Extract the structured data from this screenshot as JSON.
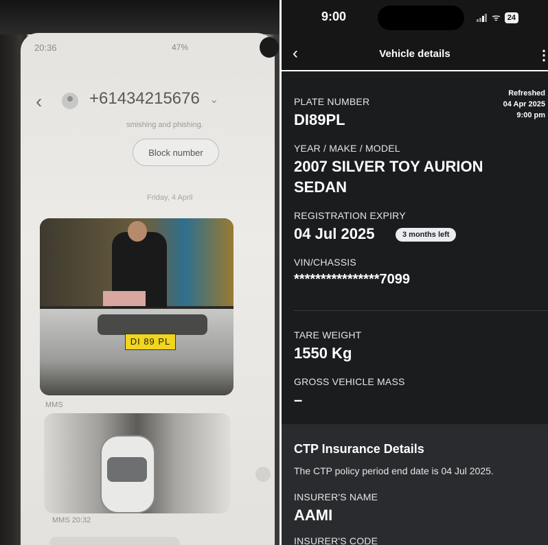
{
  "sms": {
    "status_time": "20:36",
    "status_right": "47%",
    "phone_number": "+61434215676",
    "partial_note": "smishing and phishing.",
    "block_button": "Block number",
    "date_divider": "Friday, 4 April",
    "mms1_label": "MMS",
    "plate_in_photo": "DI 89 PL",
    "mms2_label": "MMS 20:32"
  },
  "app": {
    "status_time": "9:00",
    "battery": "24",
    "nav_title": "Vehicle details",
    "refreshed": {
      "label": "Refreshed",
      "date": "04 Apr 2025",
      "time": "9:00 pm"
    },
    "fields": {
      "plate_label": "PLATE NUMBER",
      "plate_value": "DI89PL",
      "ymm_label": "YEAR / MAKE / MODEL",
      "ymm_line1": "2007 SILVER TOY AURION",
      "ymm_line2": "SEDAN",
      "rego_label": "REGISTRATION EXPIRY",
      "rego_value": "04 Jul 2025",
      "rego_badge": "3 months left",
      "vin_label": "VIN/CHASSIS",
      "vin_value": "****************7099",
      "tare_label": "TARE WEIGHT",
      "tare_value": "1550 Kg",
      "gvm_label": "GROSS VEHICLE MASS",
      "gvm_value": "–"
    },
    "ctp": {
      "title": "CTP Insurance Details",
      "text": "The CTP policy period end date is 04 Jul 2025.",
      "insurer_label": "INSURER'S NAME",
      "insurer_value": "AAMI",
      "code_label": "INSURER'S CODE"
    }
  }
}
